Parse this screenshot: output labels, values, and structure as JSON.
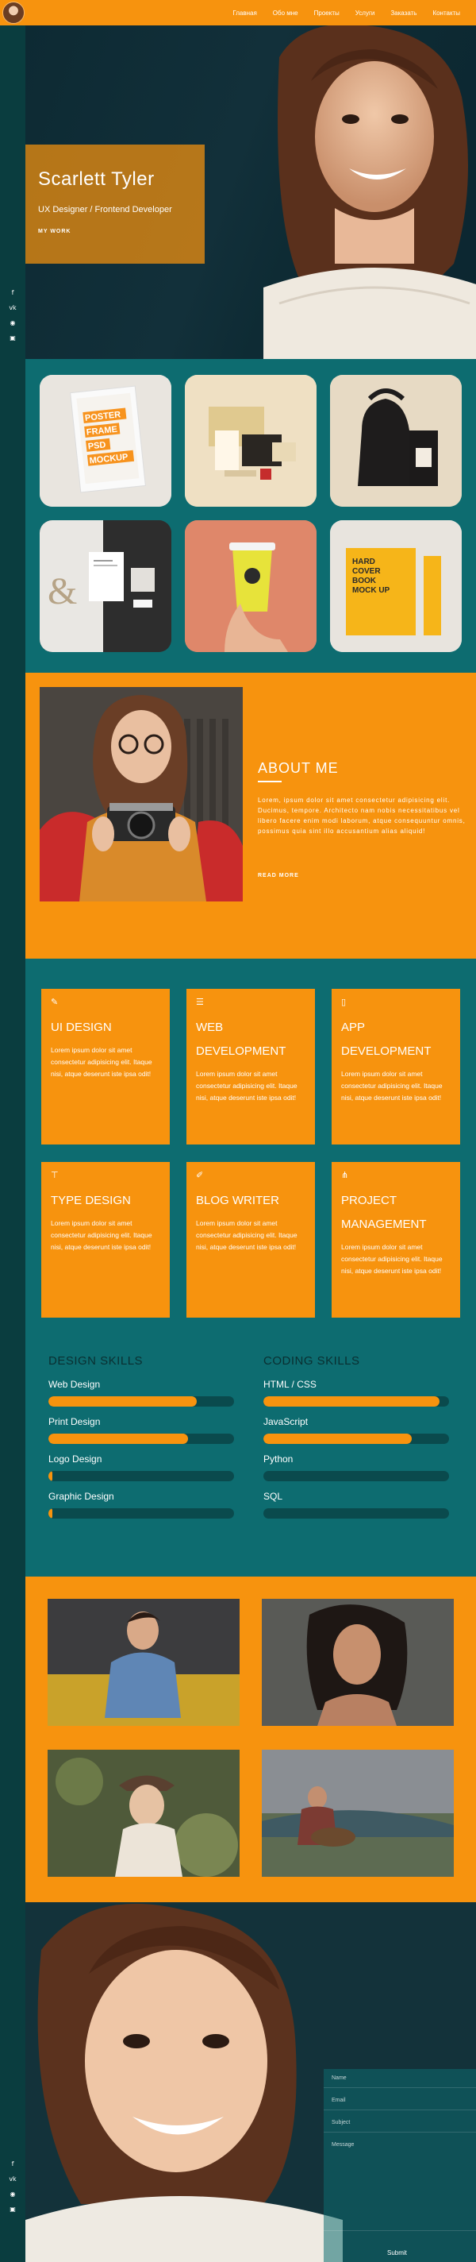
{
  "nav": {
    "items": [
      "Главная",
      "Обо мне",
      "Проекты",
      "Услуги",
      "Заказать",
      "Контакты"
    ]
  },
  "social": {
    "icons": [
      "facebook-icon",
      "vk-icon",
      "odnoklassniki-icon",
      "instagram-icon"
    ]
  },
  "hero": {
    "name": "Scarlett Tyler",
    "role": "UX Designer / Frontend Developer",
    "cta": "MY WORK"
  },
  "portfolio": {
    "items": [
      {
        "line1": "POSTER",
        "line2": "FRAME",
        "line3": "PSD",
        "line4": "MOCKUP"
      },
      {
        "line1": "",
        "line2": "",
        "line3": "",
        "line4": ""
      },
      {
        "line1": "",
        "line2": "",
        "line3": "",
        "line4": ""
      },
      {
        "line1": "&",
        "line2": "",
        "line3": "",
        "line4": ""
      },
      {
        "line1": "",
        "line2": "",
        "line3": "",
        "line4": ""
      },
      {
        "line1": "HARD",
        "line2": "COVER",
        "line3": "BOOK",
        "line4": "MOCK UP"
      }
    ]
  },
  "about": {
    "title": "ABOUT ME",
    "text": "Lorem, ipsum dolor sit amet consectetur adipisicing elit. Ducimus, tempore. Architecto nam nobis necessitatibus vel libero facere enim modi laborum, atque consequuntur omnis, possimus quia sint illo accusantium alias aliquid!",
    "cta": "READ MORE"
  },
  "services": [
    {
      "icon": "brush-icon",
      "glyph": "✎",
      "title": "UI DESIGN",
      "text": "Lorem ipsum dolor sit amet consectetur adipisicing elit. Itaque nisi, atque deserunt iste ipsa odit!"
    },
    {
      "icon": "list-icon",
      "glyph": "☰",
      "title": "WEB DEVELOPMENT",
      "text": "Lorem ipsum dolor sit amet consectetur adipisicing elit. Itaque nisi, atque deserunt iste ipsa odit!"
    },
    {
      "icon": "mobile-icon",
      "glyph": "▯",
      "title": "APP DEVELOPMENT",
      "text": "Lorem ipsum dolor sit amet consectetur adipisicing elit. Itaque nisi, atque deserunt iste ipsa odit!"
    },
    {
      "icon": "paint-roller-icon",
      "glyph": "⊤",
      "title": "TYPE DESIGN",
      "text": "Lorem ipsum dolor sit amet consectetur adipisicing elit. Itaque nisi, atque deserunt iste ipsa odit!"
    },
    {
      "icon": "edit-icon",
      "glyph": "✐",
      "title": "BLOG WRITER",
      "text": "Lorem ipsum dolor sit amet consectetur adipisicing elit. Itaque nisi, atque deserunt iste ipsa odit!"
    },
    {
      "icon": "sitemap-icon",
      "glyph": "⋔",
      "title": "PROJECT MANAGEMENT",
      "text": "Lorem ipsum dolor sit amet consectetur adipisicing elit. Itaque nisi, atque deserunt iste ipsa odit!"
    }
  ],
  "skills": {
    "design": {
      "title": "DESIGN SKILLS",
      "items": [
        {
          "label": "Web Design",
          "level": 0.8
        },
        {
          "label": "Print Design",
          "level": 0.75
        },
        {
          "label": "Logo Design",
          "level": 0.02
        },
        {
          "label": "Graphic Design",
          "level": 0.02
        }
      ]
    },
    "coding": {
      "title": "CODING SKILLS",
      "items": [
        {
          "label": "HTML / CSS",
          "level": 0.95
        },
        {
          "label": "JavaScript",
          "level": 0.8
        },
        {
          "label": "Python",
          "level": 0.0
        },
        {
          "label": "SQL",
          "level": 0.0
        }
      ]
    }
  },
  "contact": {
    "fields": [
      "Name",
      "Email",
      "Subject",
      "Message"
    ],
    "submit": "Submit"
  },
  "colors": {
    "accent": "#f7930e",
    "teal": "#0d6c70",
    "dark": "#0a3d3f"
  }
}
